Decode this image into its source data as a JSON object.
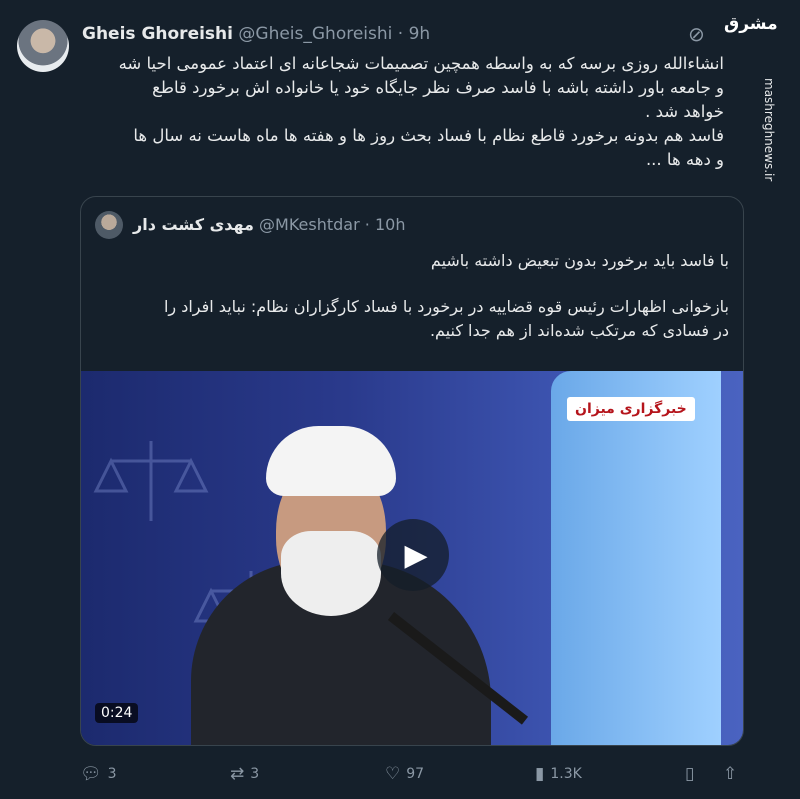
{
  "author": {
    "name": "Gheis Ghoreishi",
    "handle": "@Gheis_Ghoreishi",
    "separator": "·",
    "time": "9h"
  },
  "brand": {
    "logo_text": "مشرق",
    "watermark": "mashreghnews.ir"
  },
  "icons": {
    "grok": "grok-icon",
    "reply": "reply-icon",
    "retweet": "retweet-icon",
    "like": "heart-icon",
    "views": "views-icon",
    "bookmark": "bookmark-icon",
    "share": "share-icon",
    "play": "play-icon"
  },
  "tweet": {
    "lines": [
      "انشاءالله روزی برسه که به واسطه همچین تصمیمات شجاعانه ای اعتماد عمومی احیا شه",
      "و جامعه باور داشته باشه با فاسد صرف نظر جایگاه خود یا خانواده اش برخورد قاطع",
      "خواهد شد .",
      "فاسد هم بدونه برخورد قاطع نظام با فساد بحث روز ها و هفته ها ماه هاست نه سال ها",
      "و دهه ها ..."
    ]
  },
  "quoted": {
    "name": "مهدی کشت دار",
    "handle": "@MKeshtdar",
    "separator": "·",
    "time": "10h",
    "line1": "با فاسد باید برخورد بدون تبعیض داشته باشیم",
    "line2": "بازخوانی اظهارات رئیس قوه قضاییه در برخورد با فساد کارگزاران نظام: نباید افراد را",
    "line3": "در فسادی که مرتکب شده‌اند از هم جدا کنیم.",
    "media": {
      "badge": "خبرگزاری میزان",
      "duration": "0:24"
    }
  },
  "actions": {
    "replies": "3",
    "retweets": "3",
    "likes": "97",
    "views": "1.3K"
  },
  "colors": {
    "background": "#15202b",
    "text": "#e7e9ea",
    "muted": "#8b98a5",
    "border": "#38444d"
  }
}
